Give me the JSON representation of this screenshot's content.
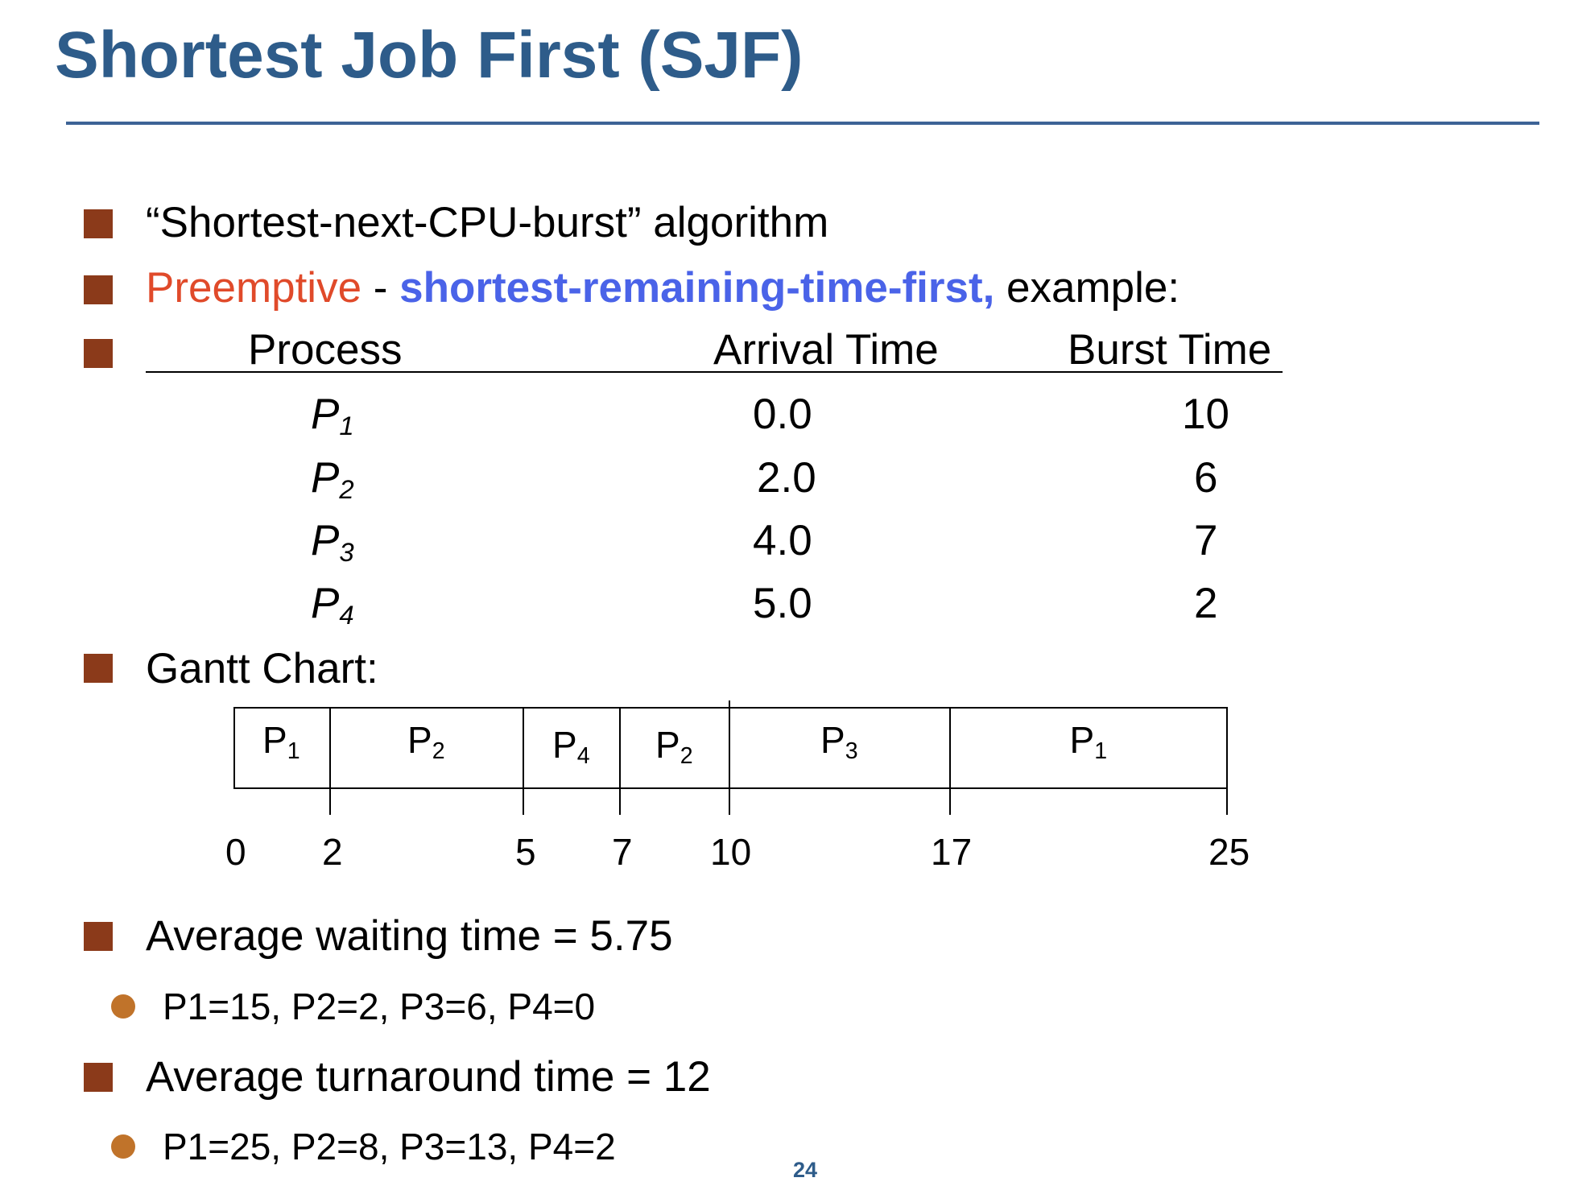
{
  "title": "Shortest Job First (SJF)",
  "bullets": {
    "b1": "“Shortest-next-CPU-burst” algorithm",
    "b2_red": "Preemptive",
    "b2_sep": " - ",
    "b2_blue": "shortest-remaining-time-first,",
    "b2_rest": " example:",
    "gantt_heading": "Gantt Chart:",
    "avg_wait": "Average waiting time = 5.75",
    "avg_wait_detail": "P1=15, P2=2, P3=6, P4=0",
    "avg_turn": "Average turnaround time = 12",
    "avg_turn_detail": "P1=25, P2=8, P3=13, P4=2"
  },
  "table": {
    "headers": [
      "Process",
      "Arrival Time",
      "Burst Time"
    ],
    "rows": [
      {
        "p": "P",
        "sub": "1",
        "arrival": "0.0",
        "burst": "10"
      },
      {
        "p": "P",
        "sub": "2",
        "arrival": "2.0",
        "burst": "6"
      },
      {
        "p": "P",
        "sub": "3",
        "arrival": "4.0",
        "burst": "7"
      },
      {
        "p": "P",
        "sub": "4",
        "arrival": "5.0",
        "burst": "2"
      }
    ]
  },
  "gantt": {
    "segments": [
      {
        "p": "P",
        "sub": "1",
        "start": 0,
        "end": 2
      },
      {
        "p": "P",
        "sub": "2",
        "start": 2,
        "end": 5
      },
      {
        "p": "P",
        "sub": "4",
        "start": 5,
        "end": 7
      },
      {
        "p": "P",
        "sub": "2",
        "start": 7,
        "end": 10
      },
      {
        "p": "P",
        "sub": "3",
        "start": 10,
        "end": 17
      },
      {
        "p": "P",
        "sub": "1",
        "start": 17,
        "end": 25
      }
    ],
    "ticks": [
      "0",
      "2",
      "5",
      "7",
      "10",
      "17",
      "25"
    ]
  },
  "page_number": "24",
  "colors": {
    "title": "#2e5c8a",
    "bullet_square": "#8b3a1a",
    "bullet_dot": "#c0732a",
    "preemptive_red": "#e04a2a",
    "srtf_blue": "#4a63e8"
  }
}
